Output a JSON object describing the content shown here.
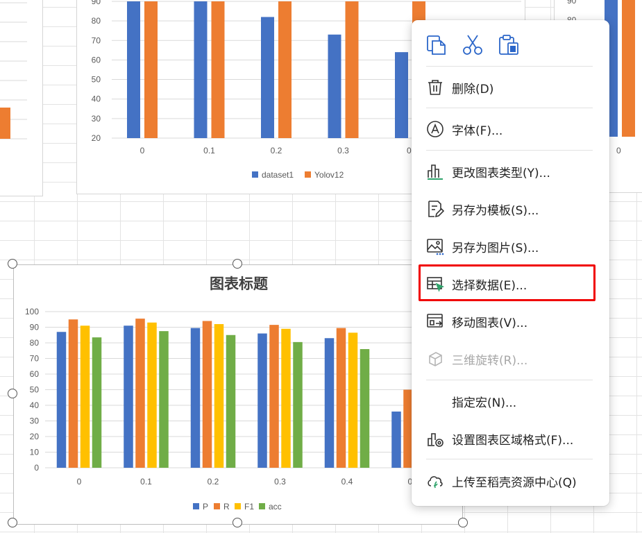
{
  "top_chart": {
    "y_ticks": [
      "20",
      "30",
      "40",
      "50",
      "60",
      "70",
      "80",
      "90"
    ],
    "categories": [
      "0",
      "0.1",
      "0.2",
      "0.3",
      "0.4"
    ],
    "category_partial": "0.",
    "legend": [
      "dataset1",
      "Yolov12"
    ]
  },
  "left_chart": {
    "y_ticks": [
      "90",
      "80",
      "70",
      "60",
      "50",
      "40",
      "30",
      "20"
    ]
  },
  "right_chart": {
    "y_ticks": [
      "90",
      "80"
    ],
    "x_label": "0"
  },
  "colors": {
    "blue": "#4472c4",
    "orange": "#ed7d31",
    "yellow": "#ffc000",
    "green": "#70ad47",
    "accent_red": "#f00000"
  },
  "chart_data": [
    {
      "type": "bar",
      "categories": [
        "0",
        "0.1",
        "0.2",
        "0.3",
        "0.4"
      ],
      "ylim": [
        20,
        90
      ],
      "series": [
        {
          "name": "dataset1",
          "values": [
            90,
            90,
            82,
            73,
            64
          ]
        },
        {
          "name": "Yolov12",
          "values": [
            90,
            90,
            90,
            90,
            90
          ]
        }
      ],
      "legend_position": "bottom"
    },
    {
      "type": "bar",
      "title": "图表标题",
      "categories": [
        "0",
        "0.1",
        "0.2",
        "0.3",
        "0.4"
      ],
      "ylim": [
        0,
        100
      ],
      "y_ticks": [
        "0",
        "10",
        "20",
        "30",
        "40",
        "50",
        "60",
        "70",
        "80",
        "90",
        "100"
      ],
      "series": [
        {
          "name": "P",
          "values": [
            87,
            91,
            89.5,
            86,
            83
          ]
        },
        {
          "name": "R",
          "values": [
            95,
            95.5,
            94,
            91.5,
            89.5
          ]
        },
        {
          "name": "F1",
          "values": [
            91,
            93,
            92,
            89,
            86.5
          ]
        },
        {
          "name": "acc",
          "values": [
            83.5,
            87.5,
            85,
            80.5,
            76
          ]
        }
      ],
      "partial_values": {
        "P": 36,
        "R": 50
      },
      "partial_category": "0.",
      "legend_position": "bottom"
    }
  ],
  "context_menu": {
    "toolbar": [
      {
        "icon": "copy-icon"
      },
      {
        "icon": "cut-icon"
      },
      {
        "icon": "paste-icon"
      }
    ],
    "items": [
      {
        "label": "删除(D)",
        "icon": "trash-icon"
      },
      {
        "label": "字体(F)...",
        "icon": "font-icon"
      },
      {
        "label": "更改图表类型(Y)...",
        "icon": "chart-type-icon"
      },
      {
        "label": "另存为模板(S)...",
        "icon": "save-template-icon"
      },
      {
        "label": "另存为图片(S)...",
        "icon": "save-image-icon"
      },
      {
        "label": "选择数据(E)...",
        "icon": "select-data-icon"
      },
      {
        "label": "移动图表(V)...",
        "icon": "move-chart-icon"
      },
      {
        "label": "三维旋转(R)...",
        "icon": "3d-rotate-icon",
        "disabled": true
      },
      {
        "label": "指定宏(N)...",
        "icon": ""
      },
      {
        "label": "设置图表区域格式(F)...",
        "icon": "format-chart-area-icon"
      },
      {
        "label": "上传至稻壳资源中心(Q)",
        "icon": "upload-icon"
      }
    ]
  }
}
